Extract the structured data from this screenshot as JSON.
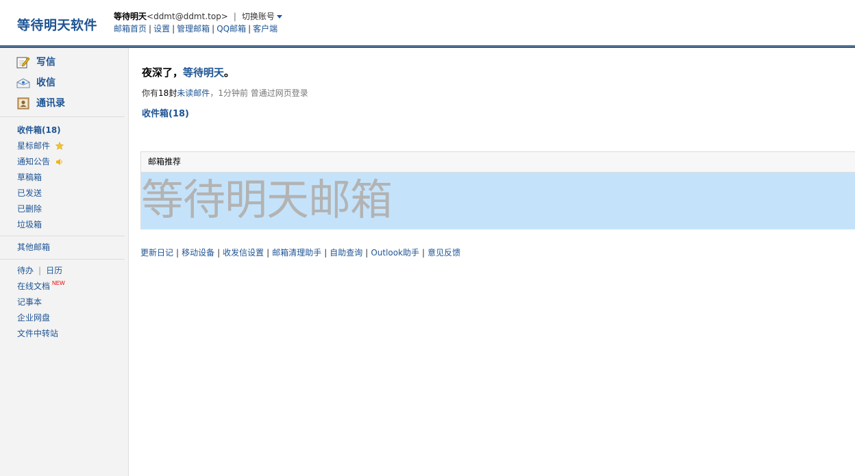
{
  "header": {
    "logo": "等待明天软件",
    "user_name": "等待明天",
    "user_email": "<ddmt@ddmt.top>",
    "separator": "|",
    "switch_account": "切换账号",
    "nav": [
      "邮箱首页",
      "设置",
      "管理邮箱",
      "QQ邮箱",
      "客户端"
    ]
  },
  "sidebar": {
    "quick": [
      {
        "label": "写信",
        "icon": "compose-icon"
      },
      {
        "label": "收信",
        "icon": "inbox-icon"
      },
      {
        "label": "通讯录",
        "icon": "contacts-icon"
      }
    ],
    "folders": [
      {
        "label": "收件箱(18)"
      },
      {
        "label": "星标邮件",
        "icon": "star-icon"
      },
      {
        "label": "通知公告",
        "icon": "speaker-icon"
      },
      {
        "label": "草稿箱"
      },
      {
        "label": "已发送"
      },
      {
        "label": "已删除"
      },
      {
        "label": "垃圾箱"
      }
    ],
    "other_mailbox": "其他邮箱",
    "todo": "待办",
    "calendar": "日历",
    "online_docs": "在线文档",
    "new_badge": "NEW",
    "notebook": "记事本",
    "enterprise_disk": "企业网盘",
    "file_transfer": "文件中转站"
  },
  "main": {
    "greeting_prefix": "夜深了，",
    "greeting_name": "等待明天",
    "greeting_suffix": "。",
    "unread_prefix": "你有",
    "unread_count": "18封",
    "unread_link": "未读邮件",
    "unread_meta": "，1分钟前 曾通过网页登录",
    "inbox_link": "收件箱(18)",
    "promo_title": "邮箱推荐",
    "promo_banner_text": "等待明天邮箱",
    "footer_links": [
      "更新日记",
      "移动设备",
      "收发信设置",
      "邮箱清理助手",
      "自助查询",
      "Outlook助手",
      "意见反馈"
    ]
  },
  "colors": {
    "link": "#1e5494",
    "header_bar": "#4e6f92",
    "banner_bg": "#c4e3fb",
    "banner_text": "#b3b3b3",
    "sidebar_bg": "#f3f3f3"
  }
}
